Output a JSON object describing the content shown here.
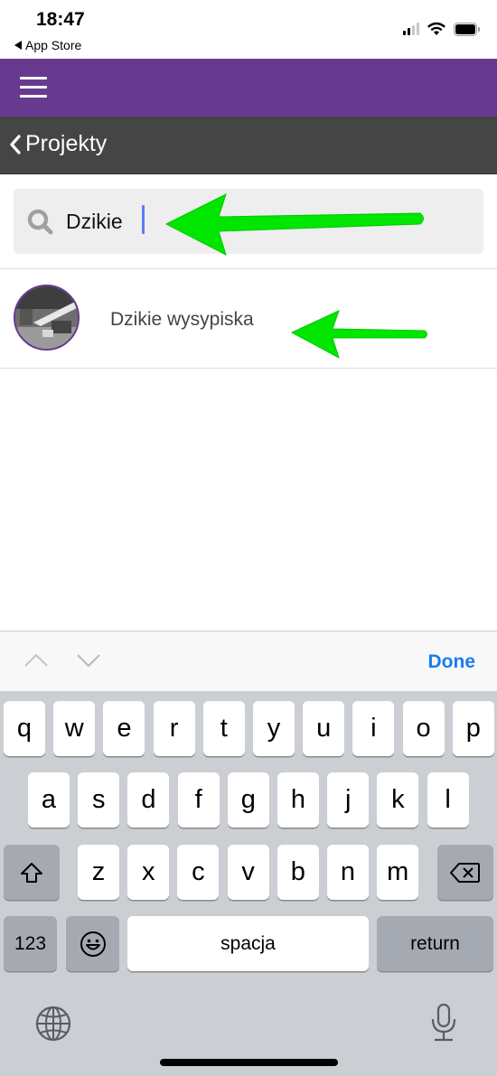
{
  "status_bar": {
    "time": "18:47",
    "back_app": "App Store",
    "signal_bars_active": 2,
    "signal_bars_total": 4,
    "battery_level_percent": 90
  },
  "app_bar": {
    "menu_icon": "hamburger-icon",
    "color": "#673a8f"
  },
  "nav_bar": {
    "back_label": "Projekty",
    "back_icon": "chevron-left-icon",
    "color": "#454545"
  },
  "search": {
    "icon": "search-icon",
    "value": "Dzikie",
    "placeholder": ""
  },
  "results": [
    {
      "label": "Dzikie wysypiska",
      "avatar": "project-thumbnail"
    }
  ],
  "annotations": {
    "arrow_color": "#00e600",
    "arrows": [
      "points-to-search-input",
      "points-to-result-item"
    ]
  },
  "keyboard_accessory": {
    "prev_icon": "chevron-up-icon",
    "next_icon": "chevron-down-icon",
    "done_label": "Done",
    "done_color": "#1a7cf0"
  },
  "keyboard": {
    "row1": [
      "q",
      "w",
      "e",
      "r",
      "t",
      "y",
      "u",
      "i",
      "o",
      "p"
    ],
    "row2": [
      "a",
      "s",
      "d",
      "f",
      "g",
      "h",
      "j",
      "k",
      "l"
    ],
    "row3": [
      "z",
      "x",
      "c",
      "v",
      "b",
      "n",
      "m"
    ],
    "shift_icon": "shift-icon",
    "backspace_icon": "backspace-icon",
    "numbers_label": "123",
    "emoji_icon": "emoji-icon",
    "space_label": "spacja",
    "return_label": "return",
    "globe_icon": "globe-icon",
    "mic_icon": "microphone-icon"
  }
}
